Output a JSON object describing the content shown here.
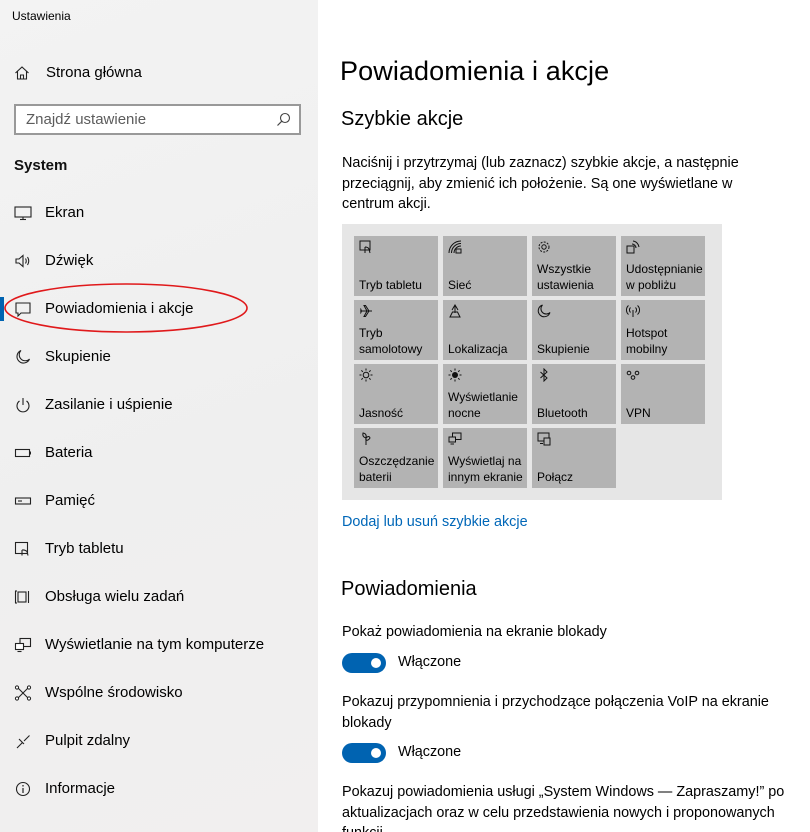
{
  "app": {
    "title": "Ustawienia"
  },
  "sidebar": {
    "home_label": "Strona główna",
    "search_placeholder": "Znajdź ustawienie",
    "section": "System",
    "items": [
      {
        "label": "Ekran",
        "icon": "monitor-icon"
      },
      {
        "label": "Dźwięk",
        "icon": "speaker-icon"
      },
      {
        "label": "Powiadomienia i akcje",
        "icon": "notification-icon",
        "selected": true
      },
      {
        "label": "Skupienie",
        "icon": "moon-icon"
      },
      {
        "label": "Zasilanie i uśpienie",
        "icon": "power-icon"
      },
      {
        "label": "Bateria",
        "icon": "battery-icon"
      },
      {
        "label": "Pamięć",
        "icon": "storage-icon"
      },
      {
        "label": "Tryb tabletu",
        "icon": "tablet-icon"
      },
      {
        "label": "Obsługa wielu zadań",
        "icon": "multitasking-icon"
      },
      {
        "label": "Wyświetlanie na tym komputerze",
        "icon": "project-icon"
      },
      {
        "label": "Wspólne środowisko",
        "icon": "shared-experience-icon"
      },
      {
        "label": "Pulpit zdalny",
        "icon": "remote-desktop-icon"
      },
      {
        "label": "Informacje",
        "icon": "info-icon"
      }
    ]
  },
  "main": {
    "title": "Powiadomienia i akcje",
    "quick_actions_heading": "Szybkie akcje",
    "quick_actions_description": "Naciśnij i przytrzymaj (lub zaznacz) szybkie akcje, a następnie przeciągnij, aby zmienić ich położenie. Są one wyświetlane w centrum akcji.",
    "tiles": [
      {
        "label": "Tryb tabletu",
        "icon": "tablet-mode-icon"
      },
      {
        "label": "Sieć",
        "icon": "network-icon"
      },
      {
        "label": "Wszystkie ustawienia",
        "icon": "gear-icon"
      },
      {
        "label": "Udostępnianie w pobliżu",
        "icon": "nearby-share-icon"
      },
      {
        "label": "Tryb samolotowy",
        "icon": "airplane-icon"
      },
      {
        "label": "Lokalizacja",
        "icon": "location-icon"
      },
      {
        "label": "Skupienie",
        "icon": "moon-icon"
      },
      {
        "label": "Hotspot mobilny",
        "icon": "hotspot-icon"
      },
      {
        "label": "Jasność",
        "icon": "brightness-icon"
      },
      {
        "label": "Wyświetlanie nocne",
        "icon": "night-light-icon"
      },
      {
        "label": "Bluetooth",
        "icon": "bluetooth-icon"
      },
      {
        "label": "VPN",
        "icon": "vpn-icon"
      },
      {
        "label": "Oszczędzanie baterii",
        "icon": "battery-saver-icon"
      },
      {
        "label": "Wyświetlaj na innym ekranie",
        "icon": "project-icon"
      },
      {
        "label": "Połącz",
        "icon": "connect-icon"
      }
    ],
    "edit_link": "Dodaj lub usuń szybkie akcje",
    "notifications_heading": "Powiadomienia",
    "settings": [
      {
        "text": "Pokaż powiadomienia na ekranie blokady",
        "state": "Włączone"
      },
      {
        "text": "Pokazuj przypomnienia i przychodzące połączenia VoIP na ekranie blokady",
        "state": "Włączone"
      },
      {
        "text": "Pokazuj powiadomienia usługi „System Windows — Zapraszamy!” po aktualizacjach oraz w celu przedstawienia nowych i proponowanych funkcji"
      }
    ]
  },
  "colors": {
    "accent": "#0063b1",
    "link": "#0067b8",
    "tile": "#b3b3b3",
    "tile_panel": "#e6e6e6",
    "annotation": "#e0191b"
  }
}
